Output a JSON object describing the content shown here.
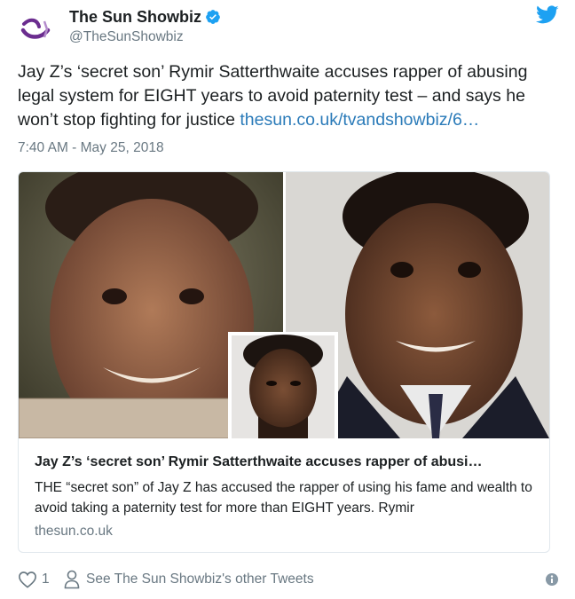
{
  "author": {
    "display_name": "The Sun Showbiz",
    "handle": "@TheSunShowbiz"
  },
  "tweet": {
    "text": "Jay Z’s ‘secret son’ Rymir Satterthwaite accuses rapper of abusing legal system for EIGHT years to avoid paternity test – and says he won’t stop fighting for justice ",
    "link": "thesun.co.uk/tvandshowbiz/6…",
    "timestamp": "7:40 AM - May 25, 2018"
  },
  "card": {
    "title": "Jay Z’s ‘secret son’ Rymir Satterthwaite accuses rapper of abusi…",
    "description": "THE “secret son” of Jay Z has accused the rapper of using his fame and wealth to avoid taking a paternity test for more than EIGHT years. Rymir",
    "domain": "thesun.co.uk"
  },
  "footer": {
    "like_count": "1",
    "other_tweets": "See The Sun Showbiz's other Tweets"
  },
  "colors": {
    "link": "#2b7bb9",
    "twitter_blue": "#1da1f2",
    "muted": "#697882",
    "brand_purple": "#6b2d8f"
  },
  "icons": [
    "sun-logo-icon",
    "verified-badge-icon",
    "twitter-bird-icon",
    "heart-icon",
    "person-icon",
    "info-icon"
  ]
}
